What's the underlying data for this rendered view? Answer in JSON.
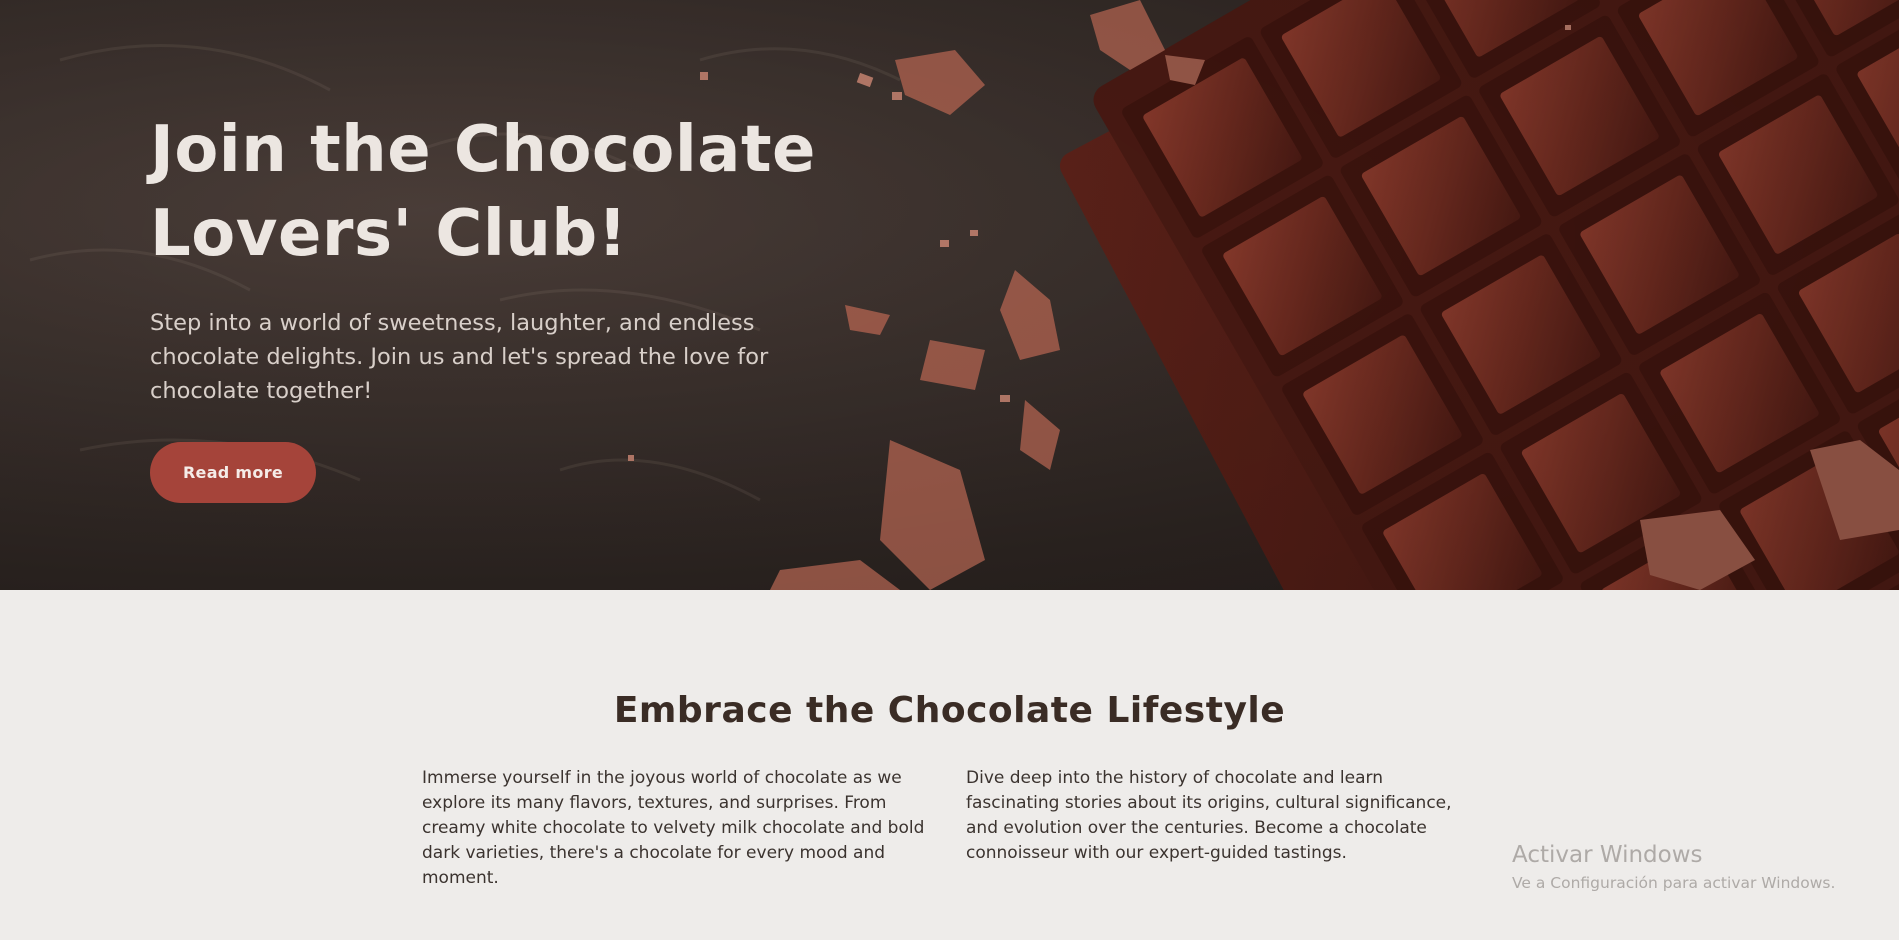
{
  "hero": {
    "title": "Join the Chocolate Lovers' Club!",
    "subtitle": "Step into a world of sweetness, laughter, and endless chocolate delights. Join us and let's spread the love for chocolate together!",
    "button_label": "Read more",
    "image_icon": "chocolate-bar-image"
  },
  "lifestyle": {
    "title": "Embrace the Chocolate Lifestyle",
    "paragraph_left": "Immerse yourself in the joyous world of chocolate as we explore its many flavors, textures, and surprises. From creamy white chocolate to velvety milk chocolate and bold dark varieties, there's a chocolate for every mood and moment.",
    "paragraph_right": "Dive deep into the history of chocolate and learn fascinating stories about its origins, cultural significance, and evolution over the centuries. Become a chocolate connoisseur with our expert-guided tastings."
  },
  "watermark": {
    "title": "Activar Windows",
    "subtitle": "Ve a Configuración para activar Windows."
  },
  "colors": {
    "hero_bg": "#2c2421",
    "accent_button": "#a5443a",
    "chocolate": "#6b2a1f",
    "section_bg": "#eeecea",
    "heading_dark": "#3a2c25"
  }
}
